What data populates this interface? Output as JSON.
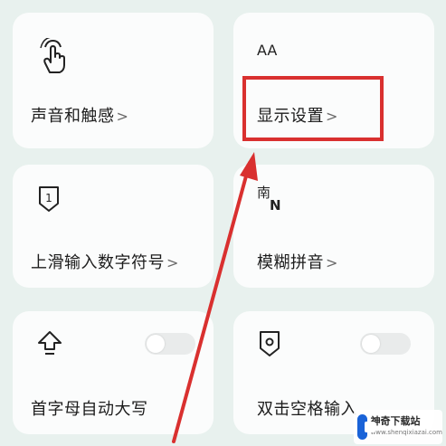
{
  "settings": [
    {
      "label": "声音和触感",
      "chevron": ">",
      "icon": "touch-hand-icon"
    },
    {
      "label": "显示设置",
      "chevron": ">",
      "icon": "font-size-icon",
      "icon_text": "AA"
    },
    {
      "label": "上滑输入数字符号",
      "chevron": ">",
      "icon": "number-one-shield-icon",
      "icon_text": "1"
    },
    {
      "label": "模糊拼音",
      "chevron": ">",
      "icon": "fuzzy-pinyin-icon",
      "icon_text_top": "南",
      "icon_text_bottom": "N"
    },
    {
      "label": "首字母自动大写",
      "icon": "shift-up-arrow-icon",
      "toggle": false
    },
    {
      "label": "双击空格输入",
      "icon": "shield-dot-icon",
      "toggle": false
    }
  ],
  "watermark": {
    "title": "神奇下载站",
    "subtitle": "www.shenqixiazai.com"
  },
  "colors": {
    "highlight": "#d9302f",
    "arrow": "#d9302f",
    "background": "#e8f1ee"
  }
}
